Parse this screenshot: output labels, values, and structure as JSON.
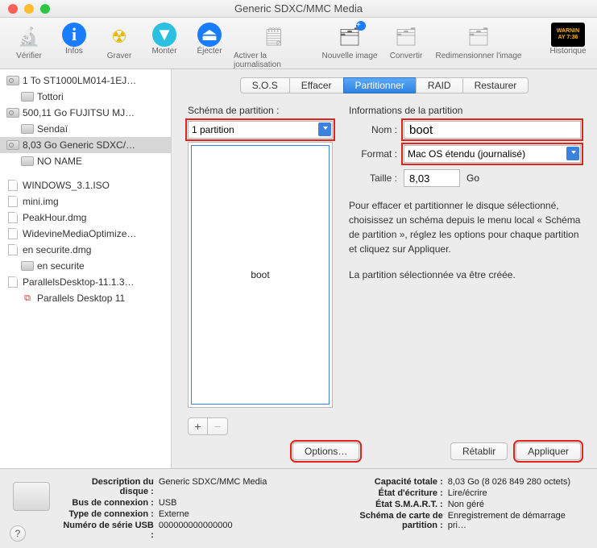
{
  "window": {
    "title": "Generic SDXC/MMC Media"
  },
  "toolbar": {
    "verify": "Vérifier",
    "info": "Infos",
    "burn": "Graver",
    "mount": "Monter",
    "eject": "Éjecter",
    "enable_journal": "Activer la journalisation",
    "new_image": "Nouvelle image",
    "convert": "Convertir",
    "resize": "Redimensionner l'image",
    "log": "Historique",
    "log_badge1": "WARNIN",
    "log_badge2": "AY 7:36"
  },
  "sidebar": {
    "items": [
      {
        "label": "1 To ST1000LM014-1EJ…",
        "icon": "hdd",
        "indent": 0
      },
      {
        "label": "Tottori",
        "icon": "drive",
        "indent": 1
      },
      {
        "label": "500,11 Go FUJITSU MJ…",
        "icon": "hdd",
        "indent": 0
      },
      {
        "label": "Sendaï",
        "icon": "drive",
        "indent": 1
      },
      {
        "label": "8,03 Go Generic SDXC/…",
        "icon": "hdd",
        "indent": 0,
        "selected": true
      },
      {
        "label": "NO NAME",
        "icon": "drive",
        "indent": 1
      },
      {
        "label": "",
        "icon": "gap",
        "indent": 0
      },
      {
        "label": "WINDOWS_3.1.ISO",
        "icon": "file",
        "indent": 0
      },
      {
        "label": "mini.img",
        "icon": "file",
        "indent": 0
      },
      {
        "label": "PeakHour.dmg",
        "icon": "file",
        "indent": 0
      },
      {
        "label": "WidevineMediaOptimize…",
        "icon": "file",
        "indent": 0
      },
      {
        "label": "en securite.dmg",
        "icon": "file",
        "indent": 0
      },
      {
        "label": "en securite",
        "icon": "drive",
        "indent": 1
      },
      {
        "label": "ParallelsDesktop-11.1.3…",
        "icon": "file",
        "indent": 0
      },
      {
        "label": "Parallels Desktop 11",
        "icon": "pkg",
        "indent": 1
      }
    ]
  },
  "tabs": {
    "items": [
      "S.O.S",
      "Effacer",
      "Partitionner",
      "RAID",
      "Restaurer"
    ],
    "active": 2
  },
  "partition": {
    "scheme_label": "Schéma de partition :",
    "scheme_value": "1 partition",
    "map_label": "boot",
    "add": "+",
    "remove": "−",
    "options": "Options…"
  },
  "info": {
    "heading": "Informations de la partition",
    "name_label": "Nom :",
    "name_value": "boot",
    "format_label": "Format :",
    "format_value": "Mac OS étendu (journalisé)",
    "size_label": "Taille :",
    "size_value": "8,03",
    "size_unit": "Go",
    "help1": "Pour effacer et partitionner le disque sélectionné, choisissez un schéma depuis le menu local « Schéma de partition », réglez les options pour chaque partition et cliquez sur Appliquer.",
    "help2": "La partition sélectionnée va être créée.",
    "revert": "Rétablir",
    "apply": "Appliquer"
  },
  "footer": {
    "left": {
      "k1": "Description du disque :",
      "v1": "Generic SDXC/MMC Media",
      "k2": "Bus de connexion :",
      "v2": "USB",
      "k3": "Type de connexion :",
      "v3": "Externe",
      "k4": "Numéro de série USB :",
      "v4": "000000000000000"
    },
    "right": {
      "k1": "Capacité totale :",
      "v1": "8,03 Go (8 026 849 280 octets)",
      "k2": "État d'écriture :",
      "v2": "Lire/écrire",
      "k3": "État S.M.A.R.T. :",
      "v3": "Non géré",
      "k4": "Schéma de carte de partition :",
      "v4": "Enregistrement de démarrage pri…"
    },
    "help": "?"
  }
}
